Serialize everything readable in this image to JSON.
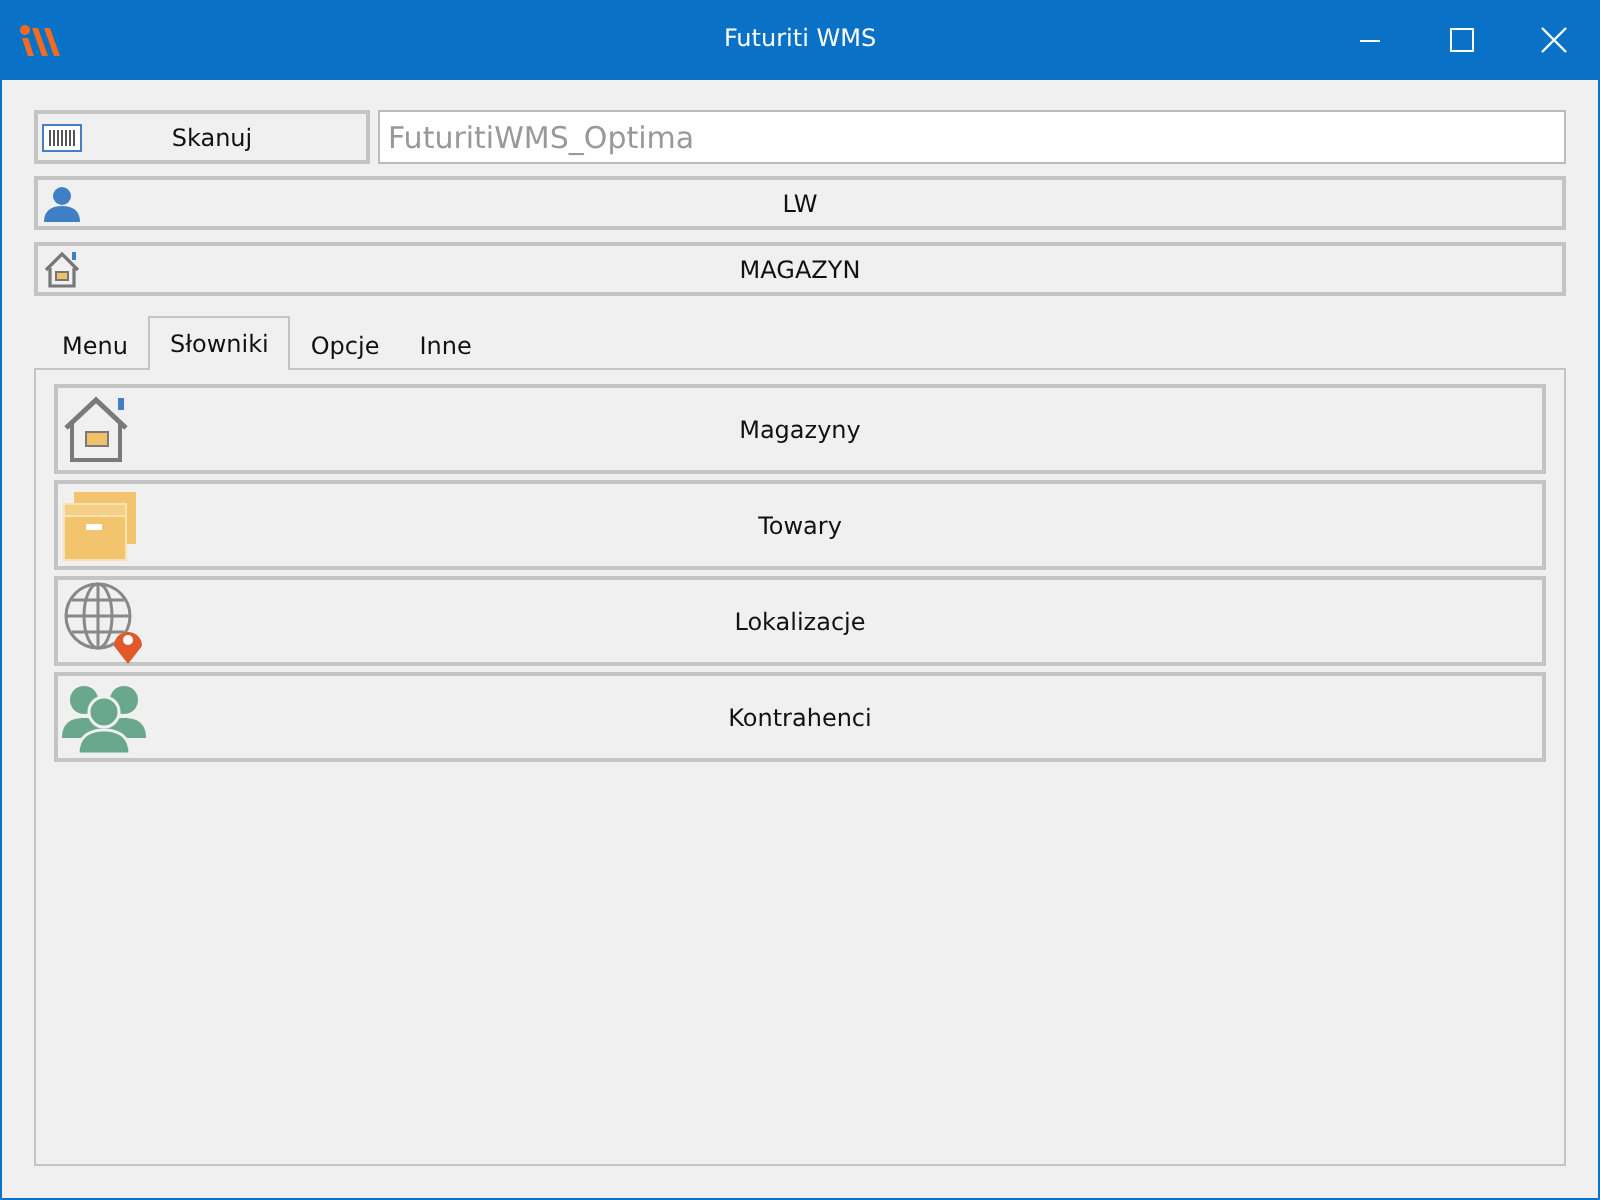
{
  "window": {
    "title": "Futuriti WMS"
  },
  "scan_button": {
    "label": "Skanuj"
  },
  "database_field": {
    "placeholder": "FuturitiWMS_Optima"
  },
  "user_button": {
    "label": "LW"
  },
  "warehouse_button": {
    "label": "MAGAZYN"
  },
  "tabs": [
    {
      "label": "Menu",
      "selected": false
    },
    {
      "label": "Słowniki",
      "selected": true
    },
    {
      "label": "Opcje",
      "selected": false
    },
    {
      "label": "Inne",
      "selected": false
    }
  ],
  "items": [
    {
      "label": "Magazyny",
      "kind": "warehouse"
    },
    {
      "label": "Towary",
      "kind": "goods"
    },
    {
      "label": "Lokalizacje",
      "kind": "location"
    },
    {
      "label": "Kontrahenci",
      "kind": "contractors"
    }
  ]
}
